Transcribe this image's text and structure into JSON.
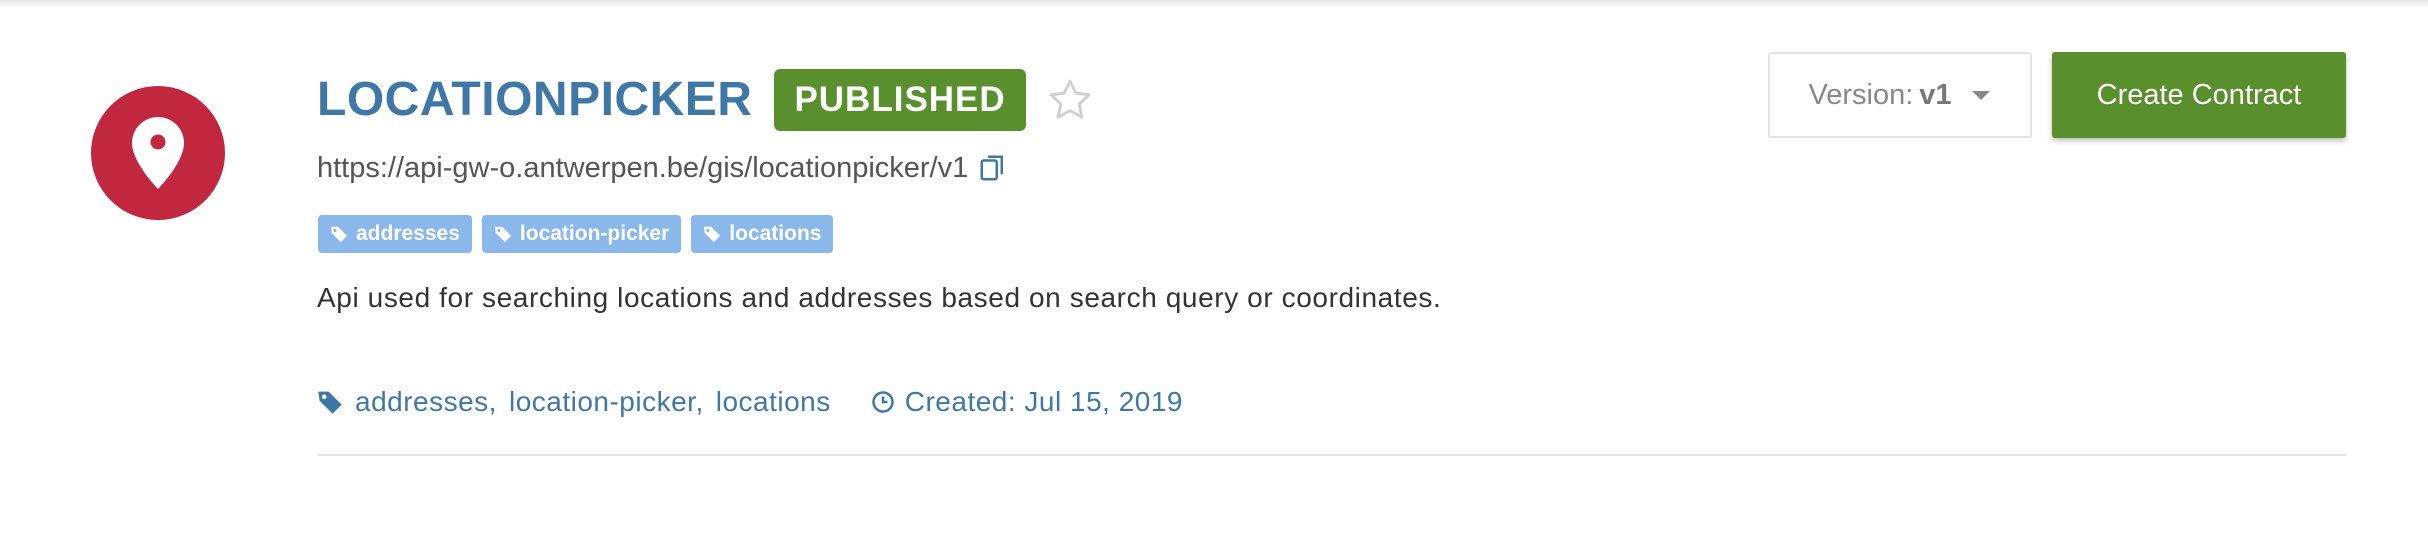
{
  "api": {
    "title": "LOCATIONPICKER",
    "status": "PUBLISHED",
    "url": "https://api-gw-o.antwerpen.be/gis/locationpicker/v1",
    "description": "Api used for searching locations and addresses based on search query or coordinates.",
    "icon": "map-marker-icon",
    "icon_color": "#c1273f"
  },
  "tags": [
    {
      "label": "addresses"
    },
    {
      "label": "location-picker"
    },
    {
      "label": "locations"
    }
  ],
  "meta": {
    "tags": [
      {
        "label": "addresses,"
      },
      {
        "label": "location-picker,"
      },
      {
        "label": "locations"
      }
    ],
    "created": "Created: Jul 15, 2019"
  },
  "version": {
    "label": "Version:",
    "value": "v1"
  },
  "actions": {
    "create_contract": "Create Contract"
  },
  "colors": {
    "primary_text": "#3f77a6",
    "success": "#5a8f2e",
    "tag_bg": "#8ab8ea"
  }
}
